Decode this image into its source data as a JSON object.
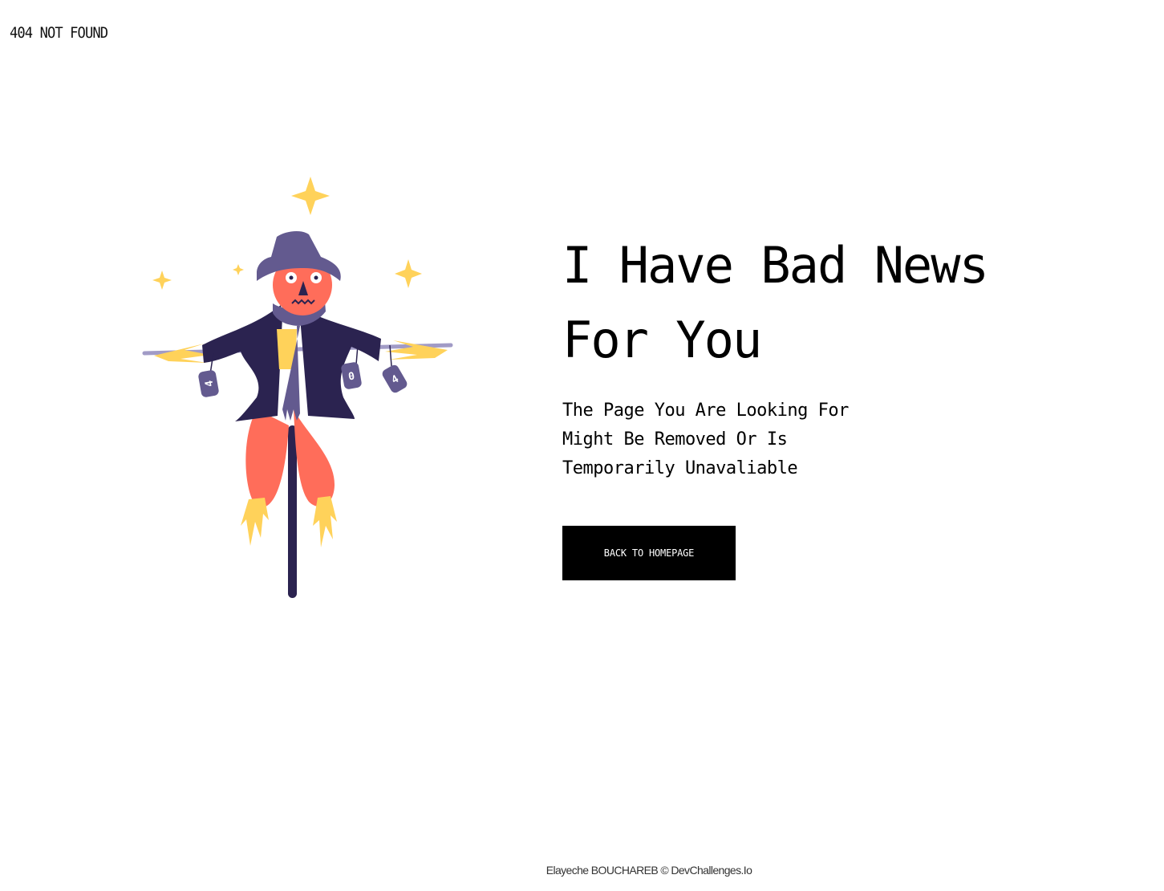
{
  "header": {
    "brand": "404 NOT FOUND"
  },
  "main": {
    "headline": "I Have Bad News For You",
    "subtext": "The Page You Are Looking For Might Be Removed Or Is Temporarily Unavaliable",
    "button_label": "BACK TO HOMEPAGE"
  },
  "illustration": {
    "name": "scarecrow",
    "can_labels": [
      "4",
      "0",
      "4"
    ]
  },
  "footer": {
    "credit": "Elayeche BOUCHAREB © DevChallenges.Io"
  },
  "colors": {
    "background": "#ffffff",
    "text": "#000000",
    "button_bg": "#000000",
    "button_text": "#ffffff",
    "scarecrow_orange": "#ff6d5a",
    "scarecrow_navy": "#2b2350",
    "scarecrow_purple": "#635a8f",
    "sparkle_yellow": "#ffd25a"
  }
}
